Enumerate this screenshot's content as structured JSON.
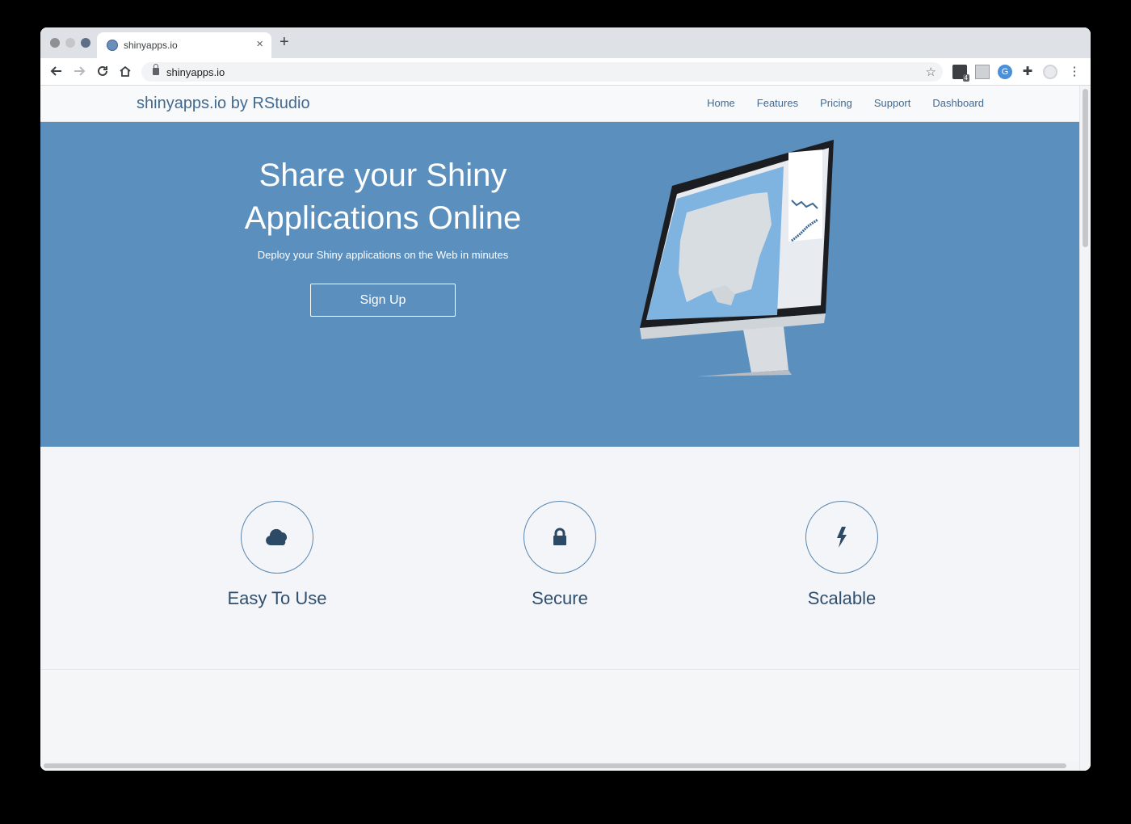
{
  "browser": {
    "tab_title": "shinyapps.io",
    "new_tab_symbol": "+",
    "close_symbol": "×",
    "url": "shinyapps.io",
    "extension_badge": "4",
    "extension_letter": "G"
  },
  "site": {
    "brand": "shinyapps.io by RStudio",
    "nav": [
      "Home",
      "Features",
      "Pricing",
      "Support",
      "Dashboard"
    ]
  },
  "hero": {
    "title": "Share your Shiny Applications Online",
    "subtitle": "Deploy your Shiny applications on the Web in minutes",
    "cta": "Sign Up",
    "background": "#5b8fbe"
  },
  "features": [
    {
      "label": "Easy To Use",
      "icon": "cloud-icon"
    },
    {
      "label": "Secure",
      "icon": "lock-icon"
    },
    {
      "label": "Scalable",
      "icon": "lightning-icon"
    }
  ],
  "colors": {
    "accent": "#3e6a96",
    "feature_text": "#2f4f6f",
    "icon": "#2c4a66"
  }
}
